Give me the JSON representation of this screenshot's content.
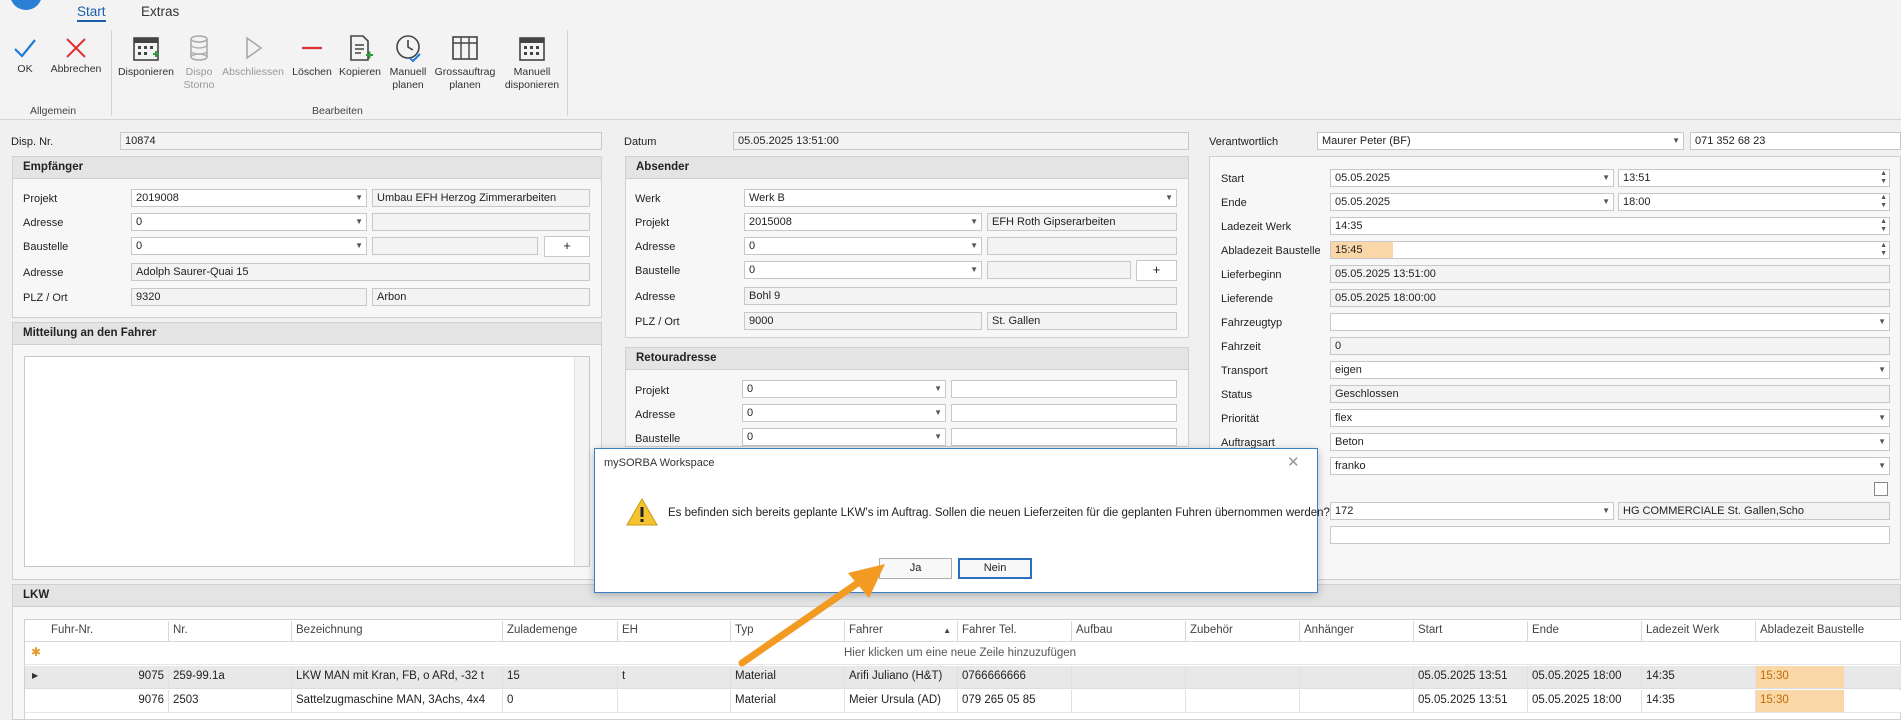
{
  "ribbon": {
    "tabs": [
      "Start",
      "Extras"
    ],
    "groups": {
      "allgemein": "Allgemein",
      "bearbeiten": "Bearbeiten"
    },
    "buttons": {
      "ok": "OK",
      "abbrechen": "Abbrechen",
      "disponieren": "Disponieren",
      "dispo_storno_1": "Dispo",
      "dispo_storno_2": "Storno",
      "abschliessen": "Abschliessen",
      "loeschen": "Löschen",
      "kopieren": "Kopieren",
      "manuell_planen_1": "Manuell",
      "manuell_planen_2": "planen",
      "gross_1": "Grossauftrag",
      "gross_2": "planen",
      "manuell_disp_1": "Manuell",
      "manuell_disp_2": "disponieren"
    }
  },
  "header": {
    "disp_nr_label": "Disp. Nr.",
    "disp_nr": "10874",
    "datum_label": "Datum",
    "datum": "05.05.2025 13:51:00",
    "verantwortlich_label": "Verantwortlich",
    "verantwortlich": "Maurer Peter (BF)",
    "telefon": "071 352 68 23"
  },
  "empfaenger": {
    "title": "Empfänger",
    "projekt_label": "Projekt",
    "projekt": "2019008",
    "projekt_desc": "Umbau EFH Herzog Zimmerarbeiten",
    "adresse_label": "Adresse",
    "adresse": "0",
    "baustelle_label": "Baustelle",
    "baustelle": "0",
    "plus": "+",
    "adresse2_label": "Adresse",
    "adresse2": "Adolph Saurer-Quai 15",
    "plz_label": "PLZ / Ort",
    "plz": "9320",
    "ort": "Arbon"
  },
  "mitteilung": {
    "title": "Mitteilung an den Fahrer"
  },
  "absender": {
    "title": "Absender",
    "werk_label": "Werk",
    "werk": "Werk B",
    "projekt_label": "Projekt",
    "projekt": "2015008",
    "projekt_desc": "EFH Roth Gipserarbeiten",
    "adresse_label": "Adresse",
    "adresse": "0",
    "baustelle_label": "Baustelle",
    "baustelle": "0",
    "plus": "+",
    "adresse2_label": "Adresse",
    "adresse2": "Bohl 9",
    "plz_label": "PLZ / Ort",
    "plz": "9000",
    "ort": "St. Gallen"
  },
  "retour": {
    "title": "Retouradresse",
    "projekt_label": "Projekt",
    "projekt": "0",
    "adresse_label": "Adresse",
    "adresse": "0",
    "baustelle_label": "Baustelle",
    "baustelle": "0"
  },
  "details": {
    "start_label": "Start",
    "start_date": "05.05.2025",
    "start_time": "13:51",
    "ende_label": "Ende",
    "ende_date": "05.05.2025",
    "ende_time": "18:00",
    "ladezeit_label": "Ladezeit Werk",
    "ladezeit": "14:35",
    "abladezeit_label": "Abladezeit Baustelle",
    "abladezeit": "15:45",
    "lieferbeginn_label": "Lieferbeginn",
    "lieferbeginn": "05.05.2025 13:51:00",
    "lieferende_label": "Lieferende",
    "lieferende": "05.05.2025 18:00:00",
    "fahrzeugtyp_label": "Fahrzeugtyp",
    "fahrzeugtyp": "",
    "fahrzeit_label": "Fahrzeit",
    "fahrzeit": "0",
    "transport_label": "Transport",
    "transport": "eigen",
    "status_label": "Status",
    "status": "Geschlossen",
    "prioritaet_label": "Priorität",
    "prioritaet": "flex",
    "auftragsart_label": "Auftragsart",
    "auftragsart": "Beton",
    "franko": "franko",
    "kunde_nr": "172",
    "kunde_name": "HG COMMERCIALE St. Gallen,Scho",
    "accent": "#f9d7a8"
  },
  "lkw": {
    "title": "LKW",
    "new_row_hint": "Hier klicken um eine neue Zeile hinzuzufügen",
    "columns": [
      "Fuhr-Nr.",
      "Nr.",
      "Bezeichnung",
      "Zulademenge",
      "EH",
      "Typ",
      "Fahrer",
      "Fahrer Tel.",
      "Aufbau",
      "Zubehör",
      "Anhänger",
      "Start",
      "Ende",
      "Ladezeit Werk",
      "Abladezeit Baustelle"
    ],
    "rows": [
      [
        "9075",
        "259-99.1a",
        "LKW MAN mit Kran, FB, o ARd, -32 t",
        "15",
        "t",
        "Material",
        "Arifi Juliano (H&T)",
        "0766666666",
        "",
        "",
        "",
        "05.05.2025 13:51",
        "05.05.2025 18:00",
        "14:35",
        "15:30"
      ],
      [
        "9076",
        "2503",
        "Sattelzugmaschine MAN, 3Achs, 4x4",
        "0",
        "",
        "Material",
        "Meier Ursula (AD)",
        "079 265 05 85",
        "",
        "",
        "",
        "05.05.2025 13:51",
        "05.05.2025 18:00",
        "14:35",
        "15:30"
      ]
    ]
  },
  "dialog": {
    "title": "mySORBA Workspace",
    "message": "Es befinden sich bereits geplante LKW's im Auftrag. Sollen die neuen Lieferzeiten für die geplanten Fuhren übernommen werden?",
    "ja": "Ja",
    "nein": "Nein"
  }
}
